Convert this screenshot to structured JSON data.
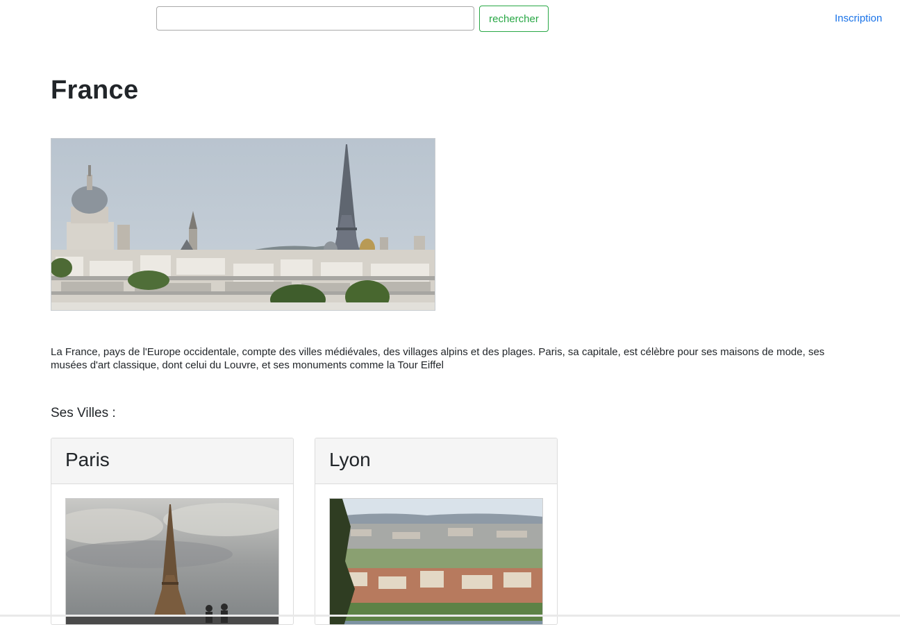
{
  "header": {
    "search_placeholder": "",
    "search_button_label": "rechercher",
    "signup_link_label": "Inscription"
  },
  "main": {
    "title": "France",
    "description": "La France, pays de l'Europe occidentale, compte des villes médiévales, des villages alpins et des plages. Paris, sa capitale, est célèbre pour ses maisons de mode, ses musées d'art classique, dont celui du Louvre, et ses monuments comme la Tour Eiffel",
    "cities_heading": "Ses Villes :",
    "cities": [
      {
        "name": "Paris"
      },
      {
        "name": "Lyon"
      }
    ]
  },
  "colors": {
    "accent_button": "#28a745",
    "link": "#1a73e8",
    "card_header_bg": "#f5f5f5"
  }
}
